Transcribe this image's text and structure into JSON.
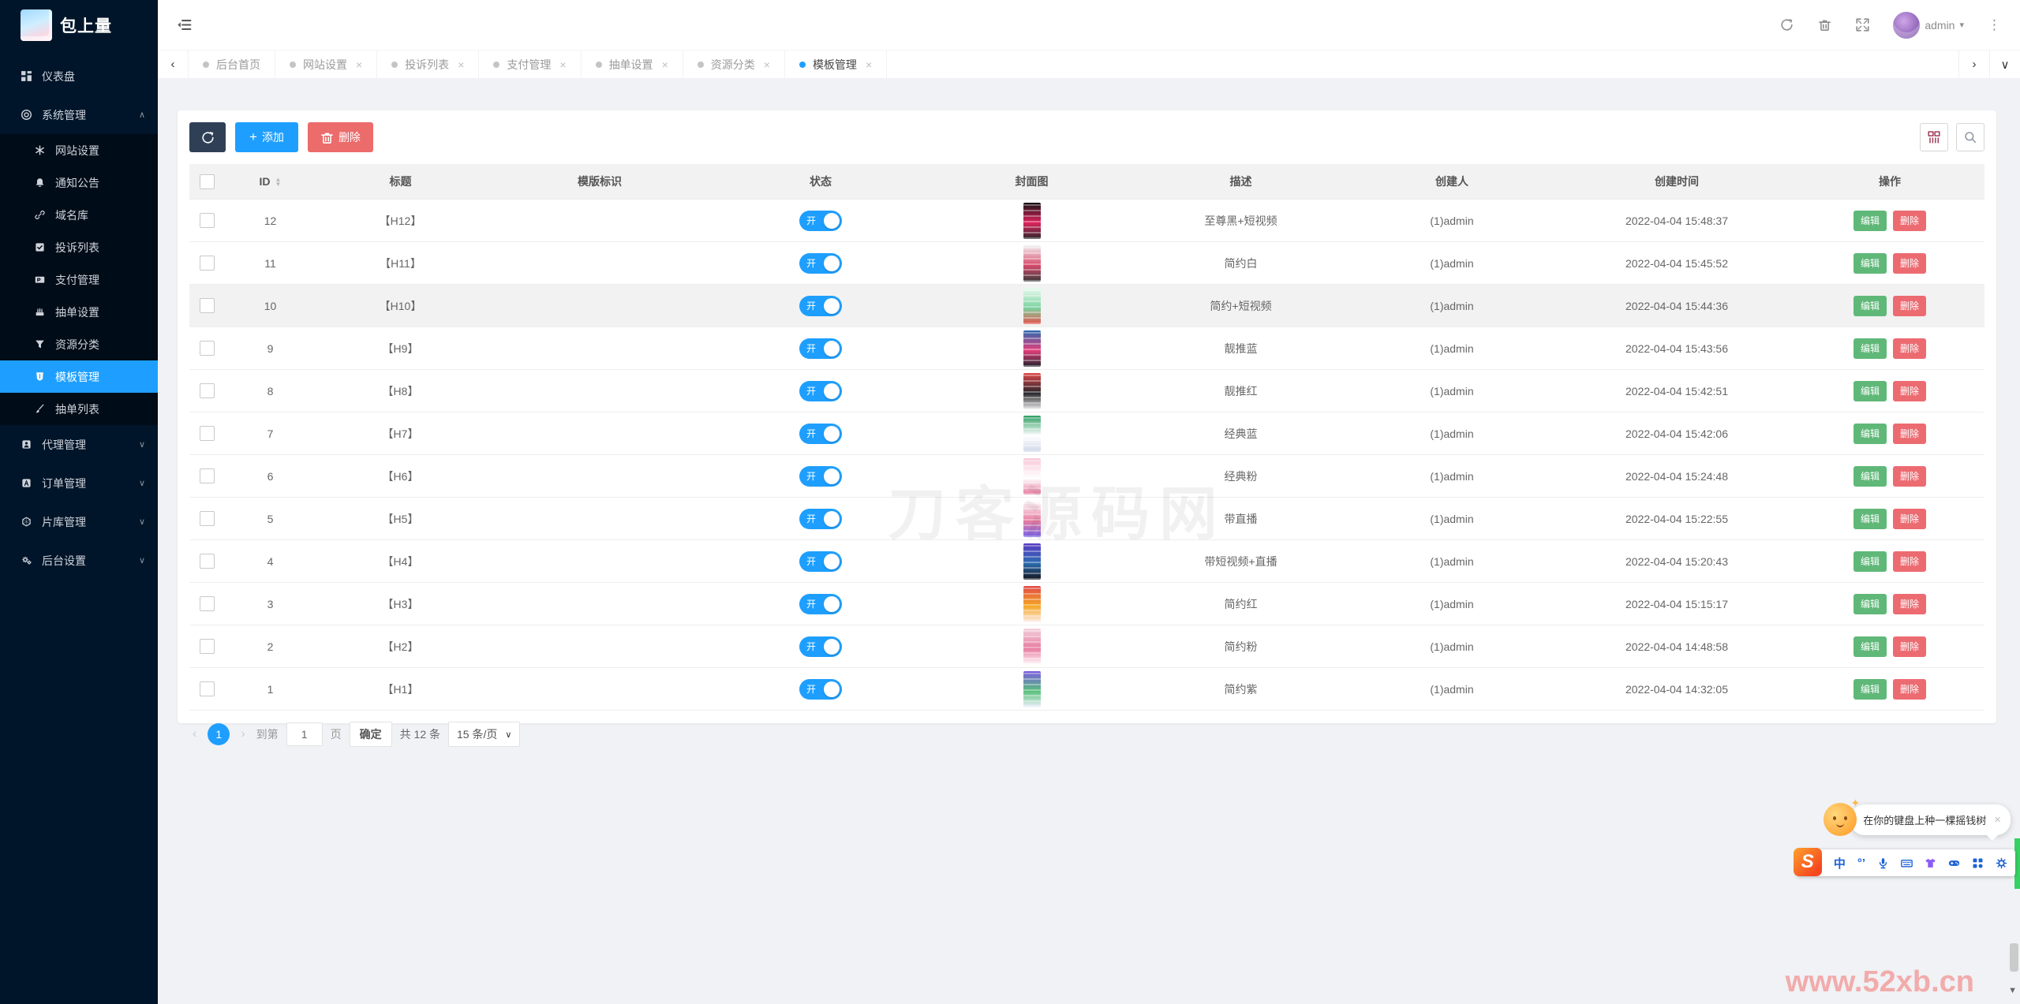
{
  "brand": {
    "title": "包上量"
  },
  "icons": {
    "close": "×",
    "chevron_left": "‹",
    "chevron_right": "›",
    "chevron_down": "∨",
    "caret_down": "∨",
    "caret_up": "∧",
    "caret_small": "▾",
    "kebab": "⋮",
    "plus": "+",
    "sort_asc": "▲",
    "sort_desc": "▼",
    "scroll_down": "▼",
    "sparkle": "✦"
  },
  "topbar": {
    "user": "admin"
  },
  "sidebar": {
    "menu": [
      {
        "id": "dashboard",
        "label": "仪表盘",
        "icon": "dashboard-icon",
        "type": "link"
      },
      {
        "id": "system-management",
        "label": "系统管理",
        "icon": "system-icon",
        "type": "group",
        "expanded": true,
        "children": [
          {
            "id": "website-settings",
            "label": "网站设置",
            "icon": "asterisk-icon"
          },
          {
            "id": "notice",
            "label": "通知公告",
            "icon": "bell-icon"
          },
          {
            "id": "domain-library",
            "label": "域名库",
            "icon": "link-icon"
          },
          {
            "id": "complaint-list",
            "label": "投诉列表",
            "icon": "check-square-icon"
          },
          {
            "id": "payment-management",
            "label": "支付管理",
            "icon": "paypal-icon"
          },
          {
            "id": "draw-settings",
            "label": "抽单设置",
            "icon": "cake-icon"
          },
          {
            "id": "resource-category",
            "label": "资源分类",
            "icon": "funnel-icon"
          },
          {
            "id": "template-management",
            "label": "模板管理",
            "icon": "shield-icon",
            "active": true
          },
          {
            "id": "draw-list",
            "label": "抽单列表",
            "icon": "brush-icon"
          }
        ]
      },
      {
        "id": "agent-management",
        "label": "代理管理",
        "icon": "agent-icon",
        "type": "group",
        "expanded": false
      },
      {
        "id": "order-management",
        "label": "订单管理",
        "icon": "order-icon",
        "type": "group",
        "expanded": false
      },
      {
        "id": "film-library",
        "label": "片库管理",
        "icon": "library-icon",
        "type": "group",
        "expanded": false
      },
      {
        "id": "backend-settings",
        "label": "后台设置",
        "icon": "gears-icon",
        "type": "group",
        "expanded": false
      }
    ]
  },
  "tabs": [
    {
      "id": "home",
      "label": "后台首页",
      "closable": false,
      "active": false
    },
    {
      "id": "website-settings",
      "label": "网站设置",
      "closable": true,
      "active": false
    },
    {
      "id": "complaint-list",
      "label": "投诉列表",
      "closable": true,
      "active": false
    },
    {
      "id": "payment-management",
      "label": "支付管理",
      "closable": true,
      "active": false
    },
    {
      "id": "draw-settings",
      "label": "抽单设置",
      "closable": true,
      "active": false
    },
    {
      "id": "resource-category",
      "label": "资源分类",
      "closable": true,
      "active": false
    },
    {
      "id": "template-management",
      "label": "模板管理",
      "closable": true,
      "active": true
    }
  ],
  "toolbar": {
    "add_label": "添加",
    "delete_label": "删除"
  },
  "table": {
    "columns": [
      "ID",
      "标题",
      "模版标识",
      "状态",
      "封面图",
      "描述",
      "创建人",
      "创建时间",
      "操作"
    ],
    "edit_label": "编辑",
    "delete_label": "删除",
    "rows": [
      {
        "id": "12",
        "title": "【H12】",
        "identifier": "",
        "status": "开",
        "desc": "至尊黑+短视频",
        "creator": "(1)admin",
        "created": "2022-04-04 15:48:37",
        "cover_colors": [
          "#141414",
          "#e0245e",
          "#2a2a2a"
        ]
      },
      {
        "id": "11",
        "title": "【H11】",
        "identifier": "",
        "status": "开",
        "desc": "简约白",
        "creator": "(1)admin",
        "created": "2022-04-04 15:45:52",
        "cover_colors": [
          "#f3f3f3",
          "#d84a6b",
          "#3a3a3a"
        ]
      },
      {
        "id": "10",
        "title": "【H10】",
        "identifier": "",
        "status": "开",
        "desc": "简约+短视频",
        "creator": "(1)admin",
        "created": "2022-04-04 15:44:36",
        "highlighted": true,
        "cover_colors": [
          "#eafaf0",
          "#7bd3a0",
          "#e5534b"
        ]
      },
      {
        "id": "9",
        "title": "【H9】",
        "identifier": "",
        "status": "开",
        "desc": "靓推蓝",
        "creator": "(1)admin",
        "created": "2022-04-04 15:43:56",
        "cover_colors": [
          "#2b6cb0",
          "#e53e7b",
          "#20242c"
        ]
      },
      {
        "id": "8",
        "title": "【H8】",
        "identifier": "",
        "status": "开",
        "desc": "靓推红",
        "creator": "(1)admin",
        "created": "2022-04-04 15:42:51",
        "cover_colors": [
          "#e04848",
          "#26262c",
          "#e9e9e9"
        ]
      },
      {
        "id": "7",
        "title": "【H7】",
        "identifier": "",
        "status": "开",
        "desc": "经典蓝",
        "creator": "(1)admin",
        "created": "2022-04-04 15:42:06",
        "cover_colors": [
          "#2f9e63",
          "#ffffff",
          "#cfd8e8"
        ]
      },
      {
        "id": "6",
        "title": "【H6】",
        "identifier": "",
        "status": "开",
        "desc": "经典粉",
        "creator": "(1)admin",
        "created": "2022-04-04 15:24:48",
        "cover_colors": [
          "#f7c8d8",
          "#ffffff",
          "#e87ca0"
        ]
      },
      {
        "id": "5",
        "title": "【H5】",
        "identifier": "",
        "status": "开",
        "desc": "带直播",
        "creator": "(1)admin",
        "created": "2022-04-04 15:22:55",
        "cover_colors": [
          "#ffffff",
          "#e87ca0",
          "#7b68ee"
        ]
      },
      {
        "id": "4",
        "title": "【H4】",
        "identifier": "",
        "status": "开",
        "desc": "带短视频+直播",
        "creator": "(1)admin",
        "created": "2022-04-04 15:20:43",
        "cover_colors": [
          "#5b3cc4",
          "#2b6cb0",
          "#15151c"
        ]
      },
      {
        "id": "3",
        "title": "【H3】",
        "identifier": "",
        "status": "开",
        "desc": "简约红",
        "creator": "(1)admin",
        "created": "2022-04-04 15:15:17",
        "cover_colors": [
          "#e04848",
          "#f5a623",
          "#fcefef"
        ]
      },
      {
        "id": "2",
        "title": "【H2】",
        "identifier": "",
        "status": "开",
        "desc": "简约粉",
        "creator": "(1)admin",
        "created": "2022-04-04 14:48:58",
        "cover_colors": [
          "#f3d1dc",
          "#e87ca0",
          "#ffffff"
        ]
      },
      {
        "id": "1",
        "title": "【H1】",
        "identifier": "",
        "status": "开",
        "desc": "简约紫",
        "creator": "(1)admin",
        "created": "2022-04-04 14:32:05",
        "cover_colors": [
          "#7b5be0",
          "#58c07a",
          "#f2f2ff"
        ]
      }
    ]
  },
  "pagination": {
    "current_page": "1",
    "goto_label": "到第",
    "page_input": "1",
    "page_suffix": "页",
    "confirm_label": "确定",
    "total_label": "共 12 条",
    "per_page": "15 条/页"
  },
  "watermarks": {
    "center": "刀客源码网",
    "corner": "www.52xb.cn"
  },
  "ime": {
    "tooltip": "在你的键盘上种一棵摇钱树",
    "logo_text": "S",
    "items": [
      {
        "id": "chinese-mode-icon",
        "text": "中"
      },
      {
        "id": "punctuation-icon",
        "text": "°’"
      },
      {
        "id": "microphone-icon"
      },
      {
        "id": "keyboard-icon"
      },
      {
        "id": "skin-icon"
      },
      {
        "id": "game-icon"
      },
      {
        "id": "apps-icon"
      },
      {
        "id": "wheel-icon"
      }
    ]
  },
  "colors": {
    "accent": "#1E9FFF",
    "green": "#5FB878",
    "red": "#ec6b6b",
    "dark_button": "#2F4056",
    "sidebar_bg": "#001529",
    "submenu_bg": "#000c17",
    "green_strip": "#36d163"
  }
}
